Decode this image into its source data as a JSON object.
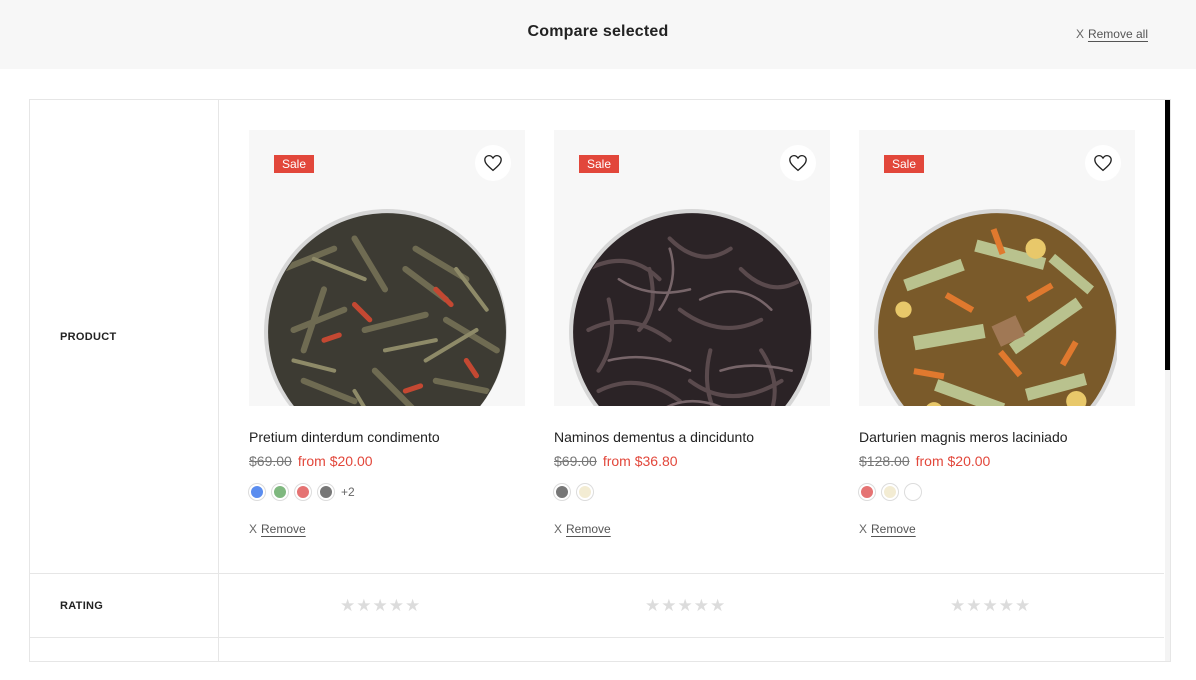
{
  "header": {
    "title": "Compare selected",
    "remove_all_x": "X",
    "remove_all_label": "Remove all"
  },
  "rows": {
    "product_label": "PRODUCT",
    "rating_label": "RATING"
  },
  "products": [
    {
      "badge": "Sale",
      "title": "Pretium dinterdum condimento",
      "old_price": "$69.00",
      "new_price": "from $20.00",
      "swatches": [
        "#5b8def",
        "#7fb87f",
        "#e57373",
        "#777777"
      ],
      "more_swatches": "+2",
      "remove_x": "X",
      "remove_label": "Remove",
      "stars": "★★★★★",
      "tea": "green-tea-with-red-pepper"
    },
    {
      "badge": "Sale",
      "title": "Naminos dementus a dinciduntо",
      "old_price": "$69.00",
      "new_price": "from $36.80",
      "swatches": [
        "#777777",
        "#f3ecd3"
      ],
      "more_swatches": "",
      "remove_x": "X",
      "remove_label": "Remove",
      "stars": "★★★★★",
      "tea": "black-tea"
    },
    {
      "badge": "Sale",
      "title": "Darturien magnis meros laciniado",
      "old_price": "$128.00",
      "new_price": "from $20.00",
      "swatches": [
        "#e57373",
        "#f3ecd3",
        "#ffffff"
      ],
      "more_swatches": "",
      "remove_x": "X",
      "remove_label": "Remove",
      "stars": "★★★★★",
      "tea": "herbal-flower-tea"
    }
  ]
}
